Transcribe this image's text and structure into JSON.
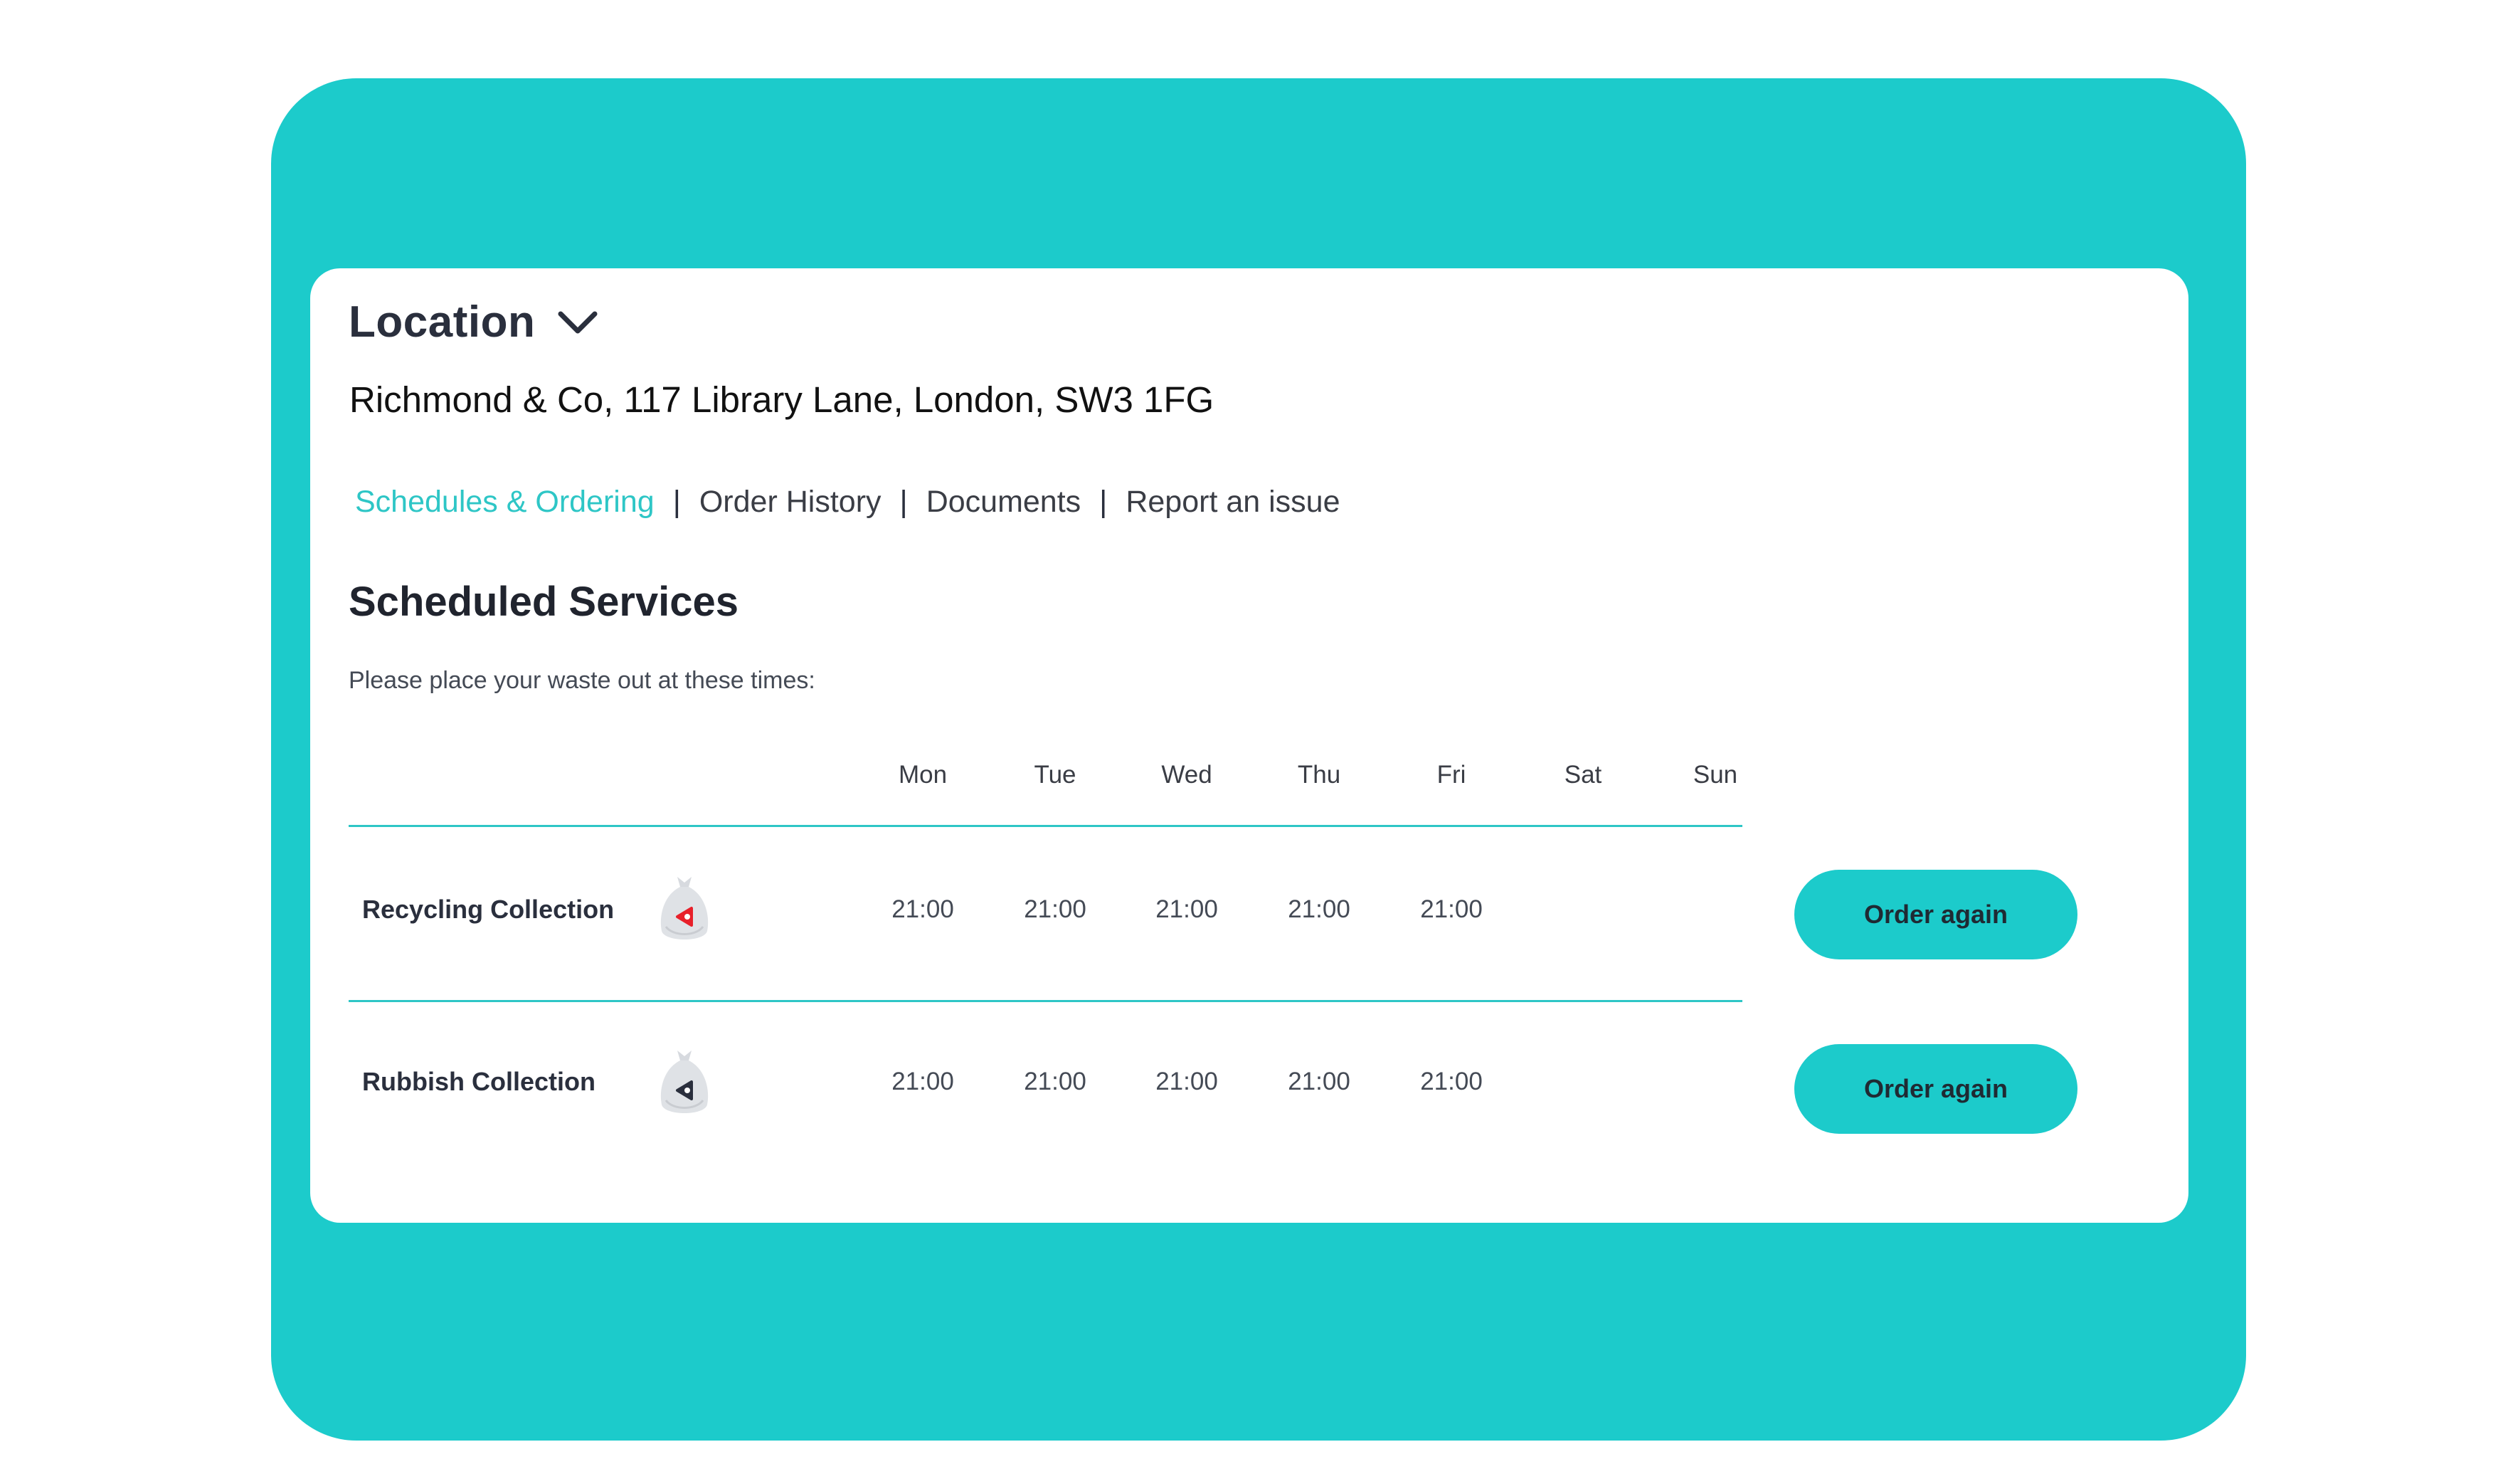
{
  "location": {
    "title": "Location",
    "address": "Richmond & Co, 117 Library Lane, London, SW3 1FG"
  },
  "tabs": [
    {
      "label": "Schedules & Ordering",
      "active": true
    },
    {
      "label": "Order History",
      "active": false
    },
    {
      "label": "Documents",
      "active": false
    },
    {
      "label": "Report an issue",
      "active": false
    }
  ],
  "section": {
    "title": "Scheduled Services",
    "subtitle": "Please place your waste out at these times:"
  },
  "days": [
    "Mon",
    "Tue",
    "Wed",
    "Thu",
    "Fri",
    "Sat",
    "Sun"
  ],
  "services": [
    {
      "name": "Recycling Collection",
      "icon": "recycling-bag-icon",
      "icon_color": "#e8202a",
      "times": [
        "21:00",
        "21:00",
        "21:00",
        "21:00",
        "21:00",
        "",
        ""
      ],
      "button_label": "Order again"
    },
    {
      "name": "Rubbish Collection",
      "icon": "rubbish-bag-icon",
      "icon_color": "#2a2f3d",
      "times": [
        "21:00",
        "21:00",
        "21:00",
        "21:00",
        "21:00",
        "",
        ""
      ],
      "button_label": "Order again"
    }
  ],
  "colors": {
    "accent": "#1ccbcb",
    "active_tab": "#2ec6c6",
    "text_dark": "#2a2f3d"
  }
}
